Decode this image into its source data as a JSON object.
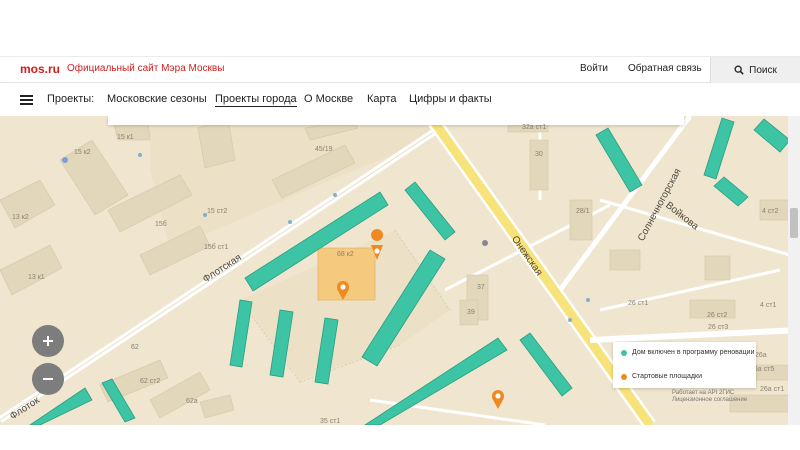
{
  "header": {
    "logo": "mos.ru",
    "site_title": "Официальный сайт Мэра Москвы",
    "login": "Войти",
    "feedback": "Обратная связь",
    "search": "Поиск",
    "search_icon": "search-icon"
  },
  "nav": {
    "label": "Проекты:",
    "items": [
      {
        "label": "Московские сезоны",
        "active": false
      },
      {
        "label": "Проекты города",
        "active": true
      },
      {
        "label": "О Москве",
        "active": false
      },
      {
        "label": "Карта",
        "active": false
      },
      {
        "label": "Цифры и факты",
        "active": false
      }
    ]
  },
  "map": {
    "streets": {
      "flotskaya": "Флотская",
      "flotsk_partial": "Флоток",
      "onezhskaya": "Онежская",
      "solnechnogorskaya": "Солнечногорская",
      "voykova": "Войкова"
    },
    "house_numbers": {
      "n15k1": "15 к1",
      "n15k2": "15 к2",
      "n13k2": "13 к2",
      "n13k1": "13 к1",
      "n45_19": "45/19",
      "n15st2": "15 ст2",
      "n15b": "15б",
      "n15b_st1": "15б ст1",
      "n68k2": "68 к2",
      "n30": "30",
      "n28_1": "28/1",
      "n37": "37",
      "n39": "39",
      "n32a_st1": "32а ст1",
      "n4_st2": "4 ст2",
      "n26_st1": "26 ст1",
      "n26_st2": "26 ст2",
      "n26_st3": "26 ст3",
      "n4_st1": "4 ст1",
      "n62": "62",
      "n62_st2": "62 ст2",
      "n62a": "62а",
      "n26a": "26а",
      "n26a_st5": "26а ст5",
      "n26a_st1": "26а ст1",
      "n35_st1": "35 ст1"
    },
    "zoom_in_icon": "plus-icon",
    "zoom_out_icon": "minus-icon",
    "colors": {
      "renovation": "#3cc4a4",
      "start_site": "#ef8a22",
      "land": "#f0e6cf",
      "building": "#e2d7bb",
      "road": "#ffffff",
      "major_road": "#f8e27a"
    }
  },
  "legend": {
    "renovation": "Дом включен в программу реновации",
    "start_sites": "Стартовые площадки"
  },
  "attribution": {
    "line1": "Работает на API 2ГИС",
    "line2": "Лицензионное соглашение"
  }
}
